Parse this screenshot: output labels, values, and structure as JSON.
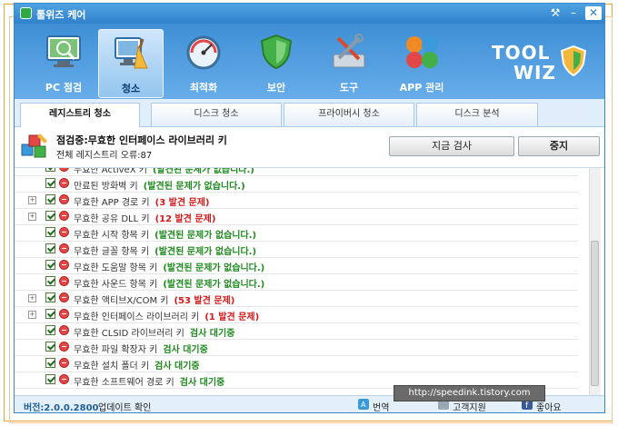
{
  "window": {
    "title": "툴위즈 케어"
  },
  "toolbar": {
    "items": [
      {
        "label": "PC 점검",
        "icon": "pc-check-icon"
      },
      {
        "label": "청소",
        "icon": "clean-icon",
        "active": true
      },
      {
        "label": "최적화",
        "icon": "optimize-icon"
      },
      {
        "label": "보안",
        "icon": "security-icon"
      },
      {
        "label": "도구",
        "icon": "tools-icon"
      },
      {
        "label": "APP 관리",
        "icon": "app-manage-icon"
      }
    ],
    "logo_line1": "TOOL",
    "logo_line2": "WIZ"
  },
  "tabs": [
    {
      "label": "레지스트리 청소",
      "active": true
    },
    {
      "label": "디스크 청소"
    },
    {
      "label": "프라이버시 청소"
    },
    {
      "label": "디스크 분석"
    }
  ],
  "status": {
    "line1": "점검중:무효한 인터페이스 라이브러리 키",
    "line2": "전체 레지스트리 오류:87",
    "scan_button": "지금 검사",
    "stop_button": "중지"
  },
  "items": [
    {
      "name": "무효한 ActiveX 키",
      "result": "(발견된 문제가 없습니다.)",
      "type": "none",
      "expand": false
    },
    {
      "name": "만료된 방화벽 키",
      "result": "(발견된 문제가 없습니다.)",
      "type": "none",
      "expand": false
    },
    {
      "name": "무효한 APP 경로 키",
      "result": "(3 발견 문제)",
      "type": "found",
      "expand": true
    },
    {
      "name": "무효한 공유 DLL 키",
      "result": "(12 발견 문제)",
      "type": "found",
      "expand": true
    },
    {
      "name": "무효한 시작 항목 키",
      "result": "(발견된 문제가 없습니다.)",
      "type": "none",
      "expand": false
    },
    {
      "name": "무효한 글꼴 항목 키",
      "result": "(발견된 문제가 없습니다.)",
      "type": "none",
      "expand": false
    },
    {
      "name": "무효한 도움말 항목 키",
      "result": "(발견된 문제가 없습니다.)",
      "type": "none",
      "expand": false
    },
    {
      "name": "무효한 사운드 항목 키",
      "result": "(발견된 문제가 없습니다.)",
      "type": "none",
      "expand": false
    },
    {
      "name": "무효한 액티브X/COM 키",
      "result": "(53 발견 문제)",
      "type": "found",
      "expand": true
    },
    {
      "name": "무효한 인터페이스 라이브러리 키",
      "result": "(1 발견 문제)",
      "type": "found",
      "expand": true
    },
    {
      "name": "무효한 CLSID 라이브러리 키",
      "result": "검사 대기중",
      "type": "wait",
      "expand": false
    },
    {
      "name": "무효한 파일 확장자 키",
      "result": "검사 대기중",
      "type": "wait",
      "expand": false
    },
    {
      "name": "무효한 설치 폴더 키",
      "result": "검사 대기중",
      "type": "wait",
      "expand": false
    },
    {
      "name": "무효한 소프트웨어 경로 키",
      "result": "검사 대기중",
      "type": "wait",
      "expand": false
    }
  ],
  "footer": {
    "version": "버전:2.0.0.2800",
    "update": "업데이트 확인",
    "translate": "번역",
    "support": "고객지원",
    "like": "좋아요"
  },
  "watermark": "http://speedink.tistory.com",
  "colors": {
    "titlebar": "#2f82cc",
    "found": "#d41a1a",
    "none": "#1e8a1e"
  }
}
